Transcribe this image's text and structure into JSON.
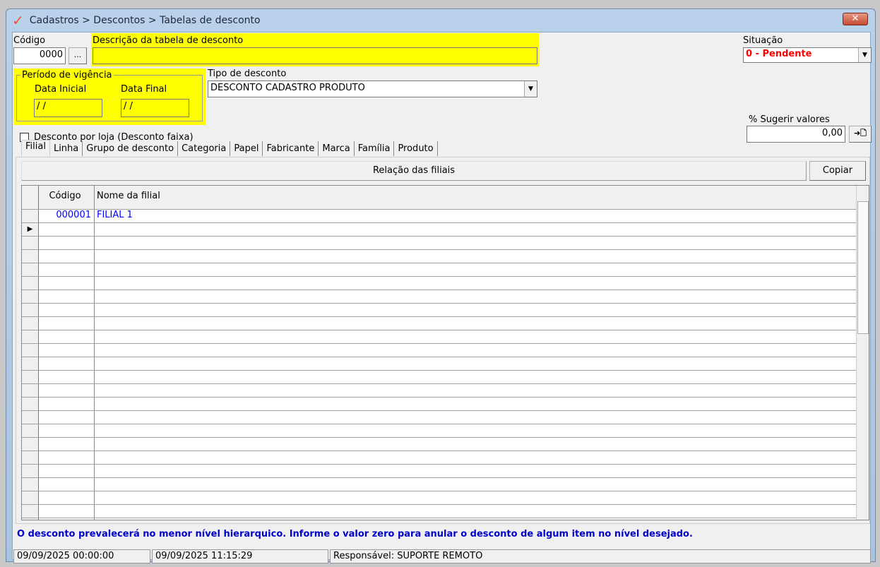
{
  "window": {
    "title": "Cadastros > Descontos > Tabelas de desconto",
    "close": "✕"
  },
  "form": {
    "codigo_label": "Código",
    "codigo_value": "0000",
    "lookup_btn": "...",
    "descricao_label": "Descrição da tabela de desconto",
    "descricao_value": "",
    "situacao_label": "Situação",
    "situacao_value": "0 - Pendente",
    "periodo_label": "Período de vigência",
    "data_inicial_label": "Data Inicial",
    "data_inicial_value": "/ /",
    "data_final_label": "Data Final",
    "data_final_value": "/ /",
    "tipo_label": "Tipo de desconto",
    "tipo_value": "DESCONTO CADASTRO PRODUTO",
    "sugerir_label": "% Sugerir valores",
    "sugerir_value": "0,00",
    "apply_btn": "➜🗋",
    "checkbox_label": "Desconto por loja (Desconto faixa)"
  },
  "tabs": [
    "Filial",
    "Linha",
    "Grupo de desconto",
    "Categoria",
    "Papel",
    "Fabricante",
    "Marca",
    "Família",
    "Produto"
  ],
  "panel": {
    "header": "Relação das filiais",
    "copy_btn": "Copiar"
  },
  "grid": {
    "columns": [
      "Código",
      "Nome da filial"
    ],
    "rows": [
      {
        "codigo": "000001",
        "nome": "FILIAL 1"
      }
    ]
  },
  "note": "O desconto prevalecerá no menor nível hierarquico. Informe o valor zero para anular o desconto de algum item no nível desejado.",
  "statusbar": [
    "09/09/2025 00:00:00",
    "09/09/2025 11:15:29",
    "Responsável: SUPORTE REMOTO"
  ],
  "colors": {
    "highlight": "#ffff00",
    "status_red": "#ff0000",
    "note_blue": "#0000cc"
  }
}
